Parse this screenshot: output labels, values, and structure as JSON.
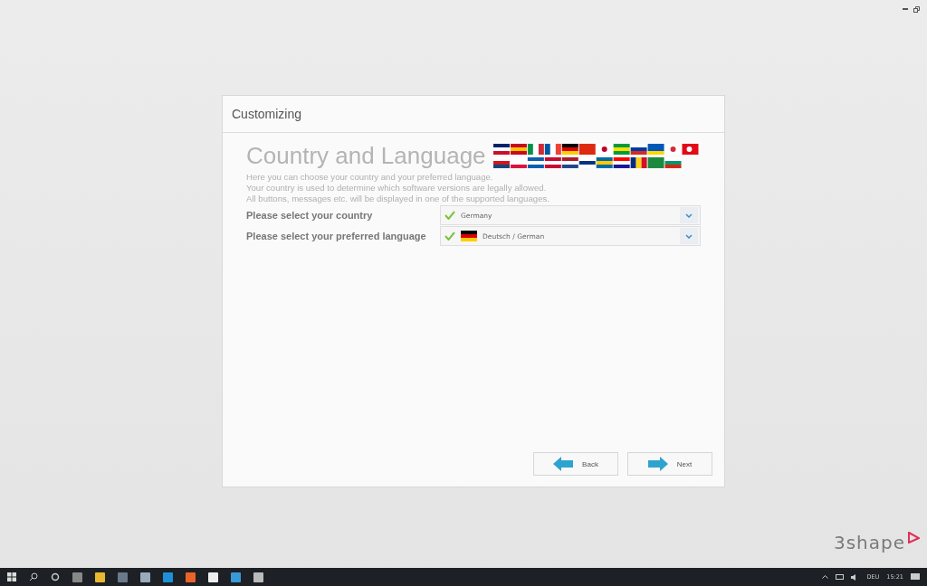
{
  "dialog": {
    "title": "Customizing",
    "heading": "Country and Language",
    "description": [
      "Here you can choose your country and your preferred language.",
      "Your country is used to determine which software versions are legally allowed.",
      "All buttons, messages etc. will be displayed in one of the supported languages."
    ],
    "fields": [
      {
        "label": "Please select your country",
        "value": "Germany",
        "valid": true,
        "has_flag": false
      },
      {
        "label": "Please select your preferred language",
        "value": "Deutsch / German",
        "valid": true,
        "has_flag": true
      }
    ],
    "buttons": [
      {
        "label": "Back",
        "kind": "back"
      },
      {
        "label": "Next",
        "kind": "next"
      }
    ]
  },
  "brand": "3shape",
  "taskbar": {
    "language": "DEU",
    "time": "15:21"
  }
}
